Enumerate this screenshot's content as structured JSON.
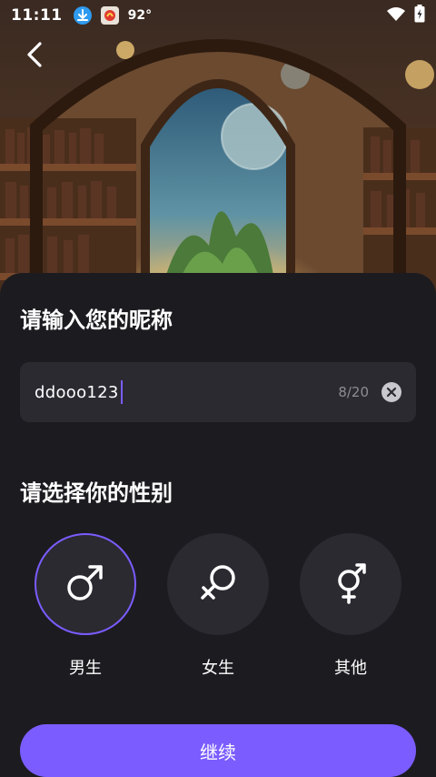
{
  "status_bar": {
    "time": "11:11",
    "temperature": "92°",
    "icons": [
      "download-icon",
      "app-notification-icon",
      "wifi-icon",
      "battery-charging-icon"
    ]
  },
  "nav": {
    "back_icon": "chevron-left-icon"
  },
  "nickname": {
    "title": "请输入您的昵称",
    "value": "ddooo123",
    "count": "8/20",
    "clear_icon": "clear-circle-icon"
  },
  "gender": {
    "title": "请选择你的性别",
    "selected": "male",
    "options": [
      {
        "id": "male",
        "label": "男生",
        "icon": "male-symbol-icon"
      },
      {
        "id": "female",
        "label": "女生",
        "icon": "female-symbol-icon"
      },
      {
        "id": "other",
        "label": "其他",
        "icon": "intersex-symbol-icon"
      }
    ]
  },
  "continue_label": "继续",
  "colors": {
    "accent": "#7b5cff",
    "background": "#1c1b20",
    "field": "#2b2a31"
  }
}
